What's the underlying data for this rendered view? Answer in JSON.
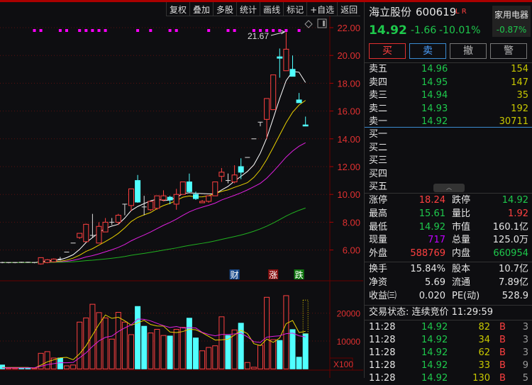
{
  "toolbar": [
    "复权",
    "叠加",
    "多股",
    "统计",
    "画线",
    "标记",
    "+自选",
    "返回"
  ],
  "stock": {
    "name": "海立股份",
    "code": "600619",
    "flags": "L R",
    "price": "14.92",
    "change": "-1.66",
    "pct": "-10.01%",
    "sector": "家用电器",
    "sector_pct": "-0.87%"
  },
  "buttons": {
    "buy": "买",
    "sell": "卖",
    "cancel": "撤",
    "alert": "警"
  },
  "sells": [
    {
      "label": "卖五",
      "price": "14.96",
      "vol": "154"
    },
    {
      "label": "卖四",
      "price": "14.95",
      "vol": "147"
    },
    {
      "label": "卖三",
      "price": "14.94",
      "vol": "35"
    },
    {
      "label": "卖二",
      "price": "14.93",
      "vol": "192"
    },
    {
      "label": "卖一",
      "price": "14.92",
      "vol": "30711"
    }
  ],
  "buys": [
    "买一",
    "买二",
    "买三",
    "买四",
    "买五"
  ],
  "stats": [
    {
      "l1": "涨停",
      "v1": "18.24",
      "c1": "r",
      "l2": "跌停",
      "v2": "14.92",
      "c2": "g"
    },
    {
      "l1": "最高",
      "v1": "15.61",
      "c1": "g",
      "l2": "量比",
      "v2": "1.92",
      "c2": "r"
    },
    {
      "l1": "最低",
      "v1": "14.92",
      "c1": "g",
      "l2": "市值",
      "v2": "160.1亿",
      "c2": "w"
    },
    {
      "l1": "现量",
      "v1": "717",
      "c1": "m",
      "l2": "总量",
      "v2": "125.0万",
      "c2": "w"
    },
    {
      "l1": "外盘",
      "v1": "588769",
      "c1": "r",
      "l2": "内盘",
      "v2": "660954",
      "c2": "g"
    }
  ],
  "fin": [
    {
      "l1": "换手",
      "v1": "15.84%",
      "l2": "股本",
      "v2": "10.7亿"
    },
    {
      "l1": "净资",
      "v1": "5.69",
      "l2": "流通",
      "v2": "7.89亿"
    },
    {
      "l1": "收益㈢",
      "v1": "0.020",
      "l2": "PE(动)",
      "v2": "528.9"
    }
  ],
  "status": "交易状态: 连续竞价 11:29:59",
  "ticks": [
    {
      "t": "11:28",
      "p": "14.92",
      "v": "82",
      "s": "B",
      "n": "3"
    },
    {
      "t": "11:28",
      "p": "14.92",
      "v": "34",
      "s": "B",
      "n": "3"
    },
    {
      "t": "11:28",
      "p": "14.92",
      "v": "62",
      "s": "B",
      "n": "3"
    },
    {
      "t": "11:28",
      "p": "14.92",
      "v": "33",
      "s": "B",
      "n": "9"
    },
    {
      "t": "11:28",
      "p": "14.92",
      "v": "130",
      "s": "B",
      "n": "5"
    }
  ],
  "chart_data": {
    "type": "candlestick",
    "price_ticks": [
      "22.00",
      "20.00",
      "18.00",
      "16.00",
      "14.00",
      "12.00",
      "10.00",
      "8.00",
      "6.00"
    ],
    "vol_ticks": [
      "20000",
      "10000"
    ],
    "vol_unit": "X100",
    "high_label": "21.67",
    "events": [
      {
        "i": 36,
        "label": "财",
        "color": "#1a4a8a"
      },
      {
        "i": 42,
        "label": "涨",
        "color": "#8a1010"
      },
      {
        "i": 46,
        "label": "跌",
        "color": "#107a10"
      }
    ],
    "signal_days": [
      5,
      6,
      9,
      10,
      12,
      13,
      14,
      15,
      16,
      21,
      23,
      26,
      27,
      32,
      35,
      36,
      39,
      40,
      41,
      42,
      43,
      44,
      46
    ],
    "candles": [
      [
        5.1,
        5.15,
        5.05,
        5.08
      ],
      [
        5.1,
        5.12,
        5.05,
        5.1
      ],
      [
        5.1,
        5.12,
        5.05,
        5.1
      ],
      [
        5.12,
        5.15,
        5.08,
        5.1
      ],
      [
        5.12,
        5.15,
        5.08,
        5.1
      ],
      [
        5.1,
        5.12,
        5.05,
        5.1
      ],
      [
        5.0,
        5.45,
        4.95,
        5.45
      ],
      [
        5.1,
        5.35,
        5.05,
        5.3
      ],
      [
        5.15,
        5.4,
        5.1,
        5.35
      ],
      [
        5.35,
        5.5,
        5.25,
        5.3
      ],
      [
        5.85,
        5.85,
        5.85,
        5.85
      ],
      [
        6.5,
        6.5,
        6.5,
        6.5
      ],
      [
        6.9,
        7.2,
        6.8,
        7.2
      ],
      [
        6.6,
        7.9,
        6.6,
        7.85
      ],
      [
        7.0,
        8.6,
        6.9,
        7.05
      ],
      [
        6.5,
        8.0,
        6.5,
        7.7
      ],
      [
        7.3,
        8.3,
        7.3,
        8.0
      ],
      [
        7.95,
        8.3,
        7.8,
        8.0
      ],
      [
        8.0,
        8.6,
        7.8,
        8.5
      ],
      [
        9.3,
        9.3,
        8.5,
        9.3
      ],
      [
        9.2,
        10.4,
        8.8,
        10.4
      ],
      [
        11.0,
        11.4,
        9.4,
        9.45
      ],
      [
        9.1,
        9.9,
        8.5,
        9.05
      ],
      [
        8.9,
        9.5,
        8.8,
        9.5
      ],
      [
        9.0,
        9.9,
        8.9,
        9.9
      ],
      [
        9.6,
        10.3,
        9.5,
        9.9
      ],
      [
        9.8,
        9.9,
        9.3,
        9.6
      ],
      [
        9.3,
        10.4,
        8.9,
        10.0
      ],
      [
        10.0,
        10.9,
        10.0,
        10.9
      ],
      [
        10.9,
        11.5,
        10.1,
        10.2
      ],
      [
        10.0,
        10.2,
        9.6,
        9.7
      ],
      [
        9.4,
        9.6,
        9.4,
        9.5
      ],
      [
        9.5,
        9.9,
        9.4,
        9.9
      ],
      [
        9.9,
        10.9,
        9.9,
        10.9
      ],
      [
        11.3,
        11.9,
        10.9,
        11.6
      ],
      [
        11.0,
        11.5,
        10.8,
        11.0
      ],
      [
        10.9,
        12.1,
        10.8,
        11.4
      ],
      [
        12.0,
        12.6,
        11.1,
        11.6
      ],
      [
        12.66,
        12.66,
        12.66,
        12.66
      ],
      [
        14.0,
        14.0,
        14.0,
        14.0
      ],
      [
        15.2,
        15.2,
        14.9,
        15.2
      ],
      [
        15.4,
        16.9,
        14.0,
        16.9
      ],
      [
        16.1,
        18.6,
        16.1,
        18.6
      ],
      [
        19.9,
        20.5,
        18.4,
        19.8
      ],
      [
        18.9,
        21.67,
        18.9,
        20.45
      ],
      [
        19.0,
        20.0,
        18.5,
        18.5
      ],
      [
        16.8,
        17.3,
        16.6,
        16.6
      ],
      [
        15.0,
        15.6,
        14.92,
        14.92
      ]
    ],
    "dir": [
      "d",
      "u",
      "u",
      "d",
      "d",
      "u",
      "u",
      "u",
      "u",
      "d",
      "u",
      "u",
      "u",
      "u",
      "u",
      "u",
      "u",
      "u",
      "u",
      "u",
      "u",
      "d",
      "d",
      "u",
      "u",
      "u",
      "d",
      "u",
      "u",
      "d",
      "d",
      "u",
      "u",
      "u",
      "u",
      "d",
      "u",
      "d",
      "u",
      "u",
      "u",
      "u",
      "u",
      "d",
      "u",
      "d",
      "d",
      "d"
    ],
    "volume": [
      1400,
      300,
      300,
      300,
      300,
      300,
      5600,
      6200,
      3900,
      3900,
      1100,
      1400,
      16800,
      18300,
      23200,
      20200,
      18300,
      10700,
      20300,
      16800,
      12300,
      22400,
      15300,
      12900,
      14200,
      12000,
      11800,
      14200,
      14900,
      18200,
      11100,
      6500,
      7700,
      8300,
      18700,
      12000,
      14000,
      16400,
      2300,
      600,
      8500,
      25700,
      10500,
      10200,
      26300,
      14100,
      4200,
      12600
    ],
    "volume_forecast": 24700
  }
}
